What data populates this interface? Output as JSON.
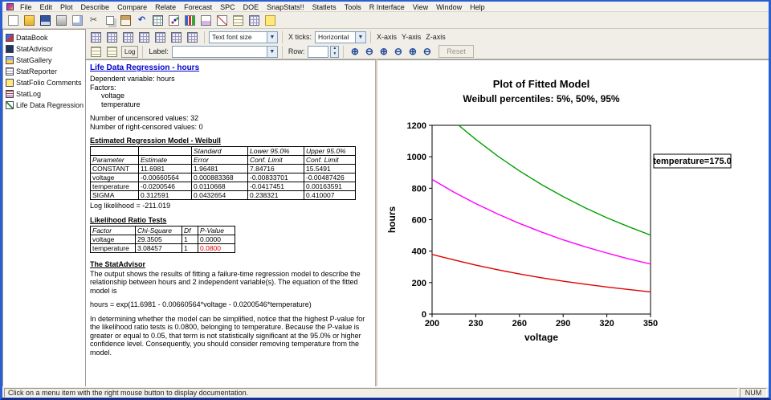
{
  "menu": {
    "items": [
      "File",
      "Edit",
      "Plot",
      "Describe",
      "Compare",
      "Relate",
      "Forecast",
      "SPC",
      "DOE",
      "SnapStats!!",
      "Statlets",
      "Tools",
      "R Interface",
      "View",
      "Window",
      "Help"
    ]
  },
  "toolbar1": {
    "buttons": [
      "new",
      "open",
      "save",
      "print",
      "preview",
      "cut",
      "copy",
      "paste",
      "undo",
      "datasheet",
      "scatter-plot",
      "bar-chart",
      "box-plot",
      "line-chart",
      "summary-table",
      "grid",
      "comments"
    ]
  },
  "sidebar": {
    "items": [
      {
        "label": "DataBook",
        "icon": "databook"
      },
      {
        "label": "StatAdvisor",
        "icon": "statadvisor"
      },
      {
        "label": "StatGallery",
        "icon": "statgallery"
      },
      {
        "label": "StatReporter",
        "icon": "statreporter"
      },
      {
        "label": "StatFolio Comments",
        "icon": "statfolio-comments"
      },
      {
        "label": "StatLog",
        "icon": "statlog"
      },
      {
        "label": "Life Data Regression - hou",
        "icon": "analysis"
      }
    ]
  },
  "toolbar2": {
    "row1_icons": [
      "input-dialog",
      "tables-and-graphs",
      "analysis-options",
      "graphics-options",
      "save-graph",
      "print-graph",
      "copy-graph"
    ],
    "row2_icons": [
      "toggle-grid",
      "rotate-plot"
    ],
    "log_label": "Log",
    "text_font_size": "Text font size",
    "xticks_label": "X ticks:",
    "xticks_value": "Horizontal",
    "xaxis_label": "X-axis",
    "yaxis_label": "Y-axis",
    "zaxis_label": "Z-axis",
    "label_label": "Label:",
    "label_value": "",
    "row_label": "Row:",
    "row_value": "",
    "zoom_buttons": [
      {
        "name": "zoom-in-x",
        "kind": "in"
      },
      {
        "name": "zoom-out-x",
        "kind": "out"
      },
      {
        "name": "zoom-in-y",
        "kind": "in"
      },
      {
        "name": "zoom-out-y",
        "kind": "out"
      },
      {
        "name": "zoom-in-z",
        "kind": "in"
      },
      {
        "name": "zoom-out-z",
        "kind": "out"
      }
    ],
    "reset_label": "Reset"
  },
  "report": {
    "title": "Life Data Regression - hours",
    "dependent_line": "Dependent variable: hours",
    "factors_label": "Factors:",
    "factors": [
      "voltage",
      "temperature"
    ],
    "uncensored_line": "Number of uncensored values: 32",
    "censored_line": "Number of right-censored values: 0",
    "model_section_title": "Estimated Regression Model - Weibull",
    "model_table": {
      "header_row1": [
        "",
        "",
        "Standard",
        "Lower 95.0%",
        "Upper 95.0%"
      ],
      "header_row2": [
        "Parameter",
        "Estimate",
        "Error",
        "Conf. Limit",
        "Conf. Limit"
      ],
      "rows": [
        [
          "CONSTANT",
          "11.6981",
          "1.96481",
          "7.84716",
          "15.5491"
        ],
        [
          "voltage",
          "-0.00660564",
          "0.000883368",
          "-0.00833701",
          "-0.00487426"
        ],
        [
          "temperature",
          "-0.0200546",
          "0.0110668",
          "-0.0417451",
          "0.00163591"
        ],
        [
          "SIGMA",
          "0.312591",
          "0.0432654",
          "0.238321",
          "0.410007"
        ]
      ]
    },
    "log_likelihood": "Log likelihood = -211.019",
    "lrt_section_title": "Likelihood Ratio Tests",
    "lrt_table": {
      "headers": [
        "Factor",
        "Chi-Square",
        "Df",
        "P-Value"
      ],
      "rows": [
        {
          "cells": [
            "voltage",
            "29.3505",
            "1",
            "0.0000"
          ],
          "highlight": false
        },
        {
          "cells": [
            "temperature",
            "3.08457",
            "1",
            "0.0800"
          ],
          "highlight": true
        }
      ]
    },
    "statadvisor_title": "The StatAdvisor",
    "para1": "The output shows the results of fitting a failure-time regression model to describe the relationship between hours and 2 independent variable(s).  The equation of the fitted model is",
    "equation": "hours = exp(11.6981 - 0.00660564*voltage - 0.0200546*temperature)",
    "para2": "In determining whether the model can be simplified, notice that the highest P-value for the likelihood ratio tests is 0.0800, belonging to temperature.  Because the P-value is greater or equal to 0.05, that term is not statistically significant at the 95.0% or higher confidence level.  Consequently, you should consider removing temperature from the model."
  },
  "chart_data": {
    "type": "line",
    "title": "Plot of Fitted Model",
    "subtitle": "Weibull percentiles: 5%,  50%,  95%",
    "xlabel": "voltage",
    "ylabel": "hours",
    "xlim": [
      200,
      350
    ],
    "ylim": [
      0,
      1200
    ],
    "xticks": [
      200,
      230,
      260,
      290,
      320,
      350
    ],
    "yticks": [
      0,
      200,
      400,
      600,
      800,
      1000,
      1200
    ],
    "grid": false,
    "legend_position": "none",
    "annotation": "temperature=175.0",
    "x": [
      200,
      215,
      230,
      245,
      260,
      275,
      290,
      305,
      320,
      335,
      350
    ],
    "series": [
      {
        "name": "95%",
        "color": "#00a000",
        "values": [
          1353,
          1225,
          1110,
          1005,
          910,
          824,
          747,
          676,
          612,
          555,
          502
        ]
      },
      {
        "name": "50%",
        "color": "#ff00ff",
        "values": [
          856,
          775,
          702,
          636,
          576,
          522,
          472,
          428,
          388,
          351,
          318
        ]
      },
      {
        "name": "5%",
        "color": "#e00000",
        "values": [
          379,
          344,
          311,
          282,
          255,
          231,
          209,
          190,
          172,
          156,
          141
        ]
      }
    ]
  },
  "statusbar": {
    "message": "Click on a menu item with the right mouse button to display documentation.",
    "num": "NUM"
  }
}
